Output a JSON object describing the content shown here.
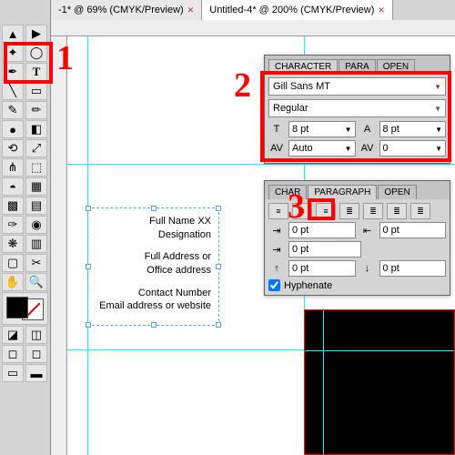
{
  "tabs": [
    {
      "label": "-1* @ 69% (CMYK/Preview)"
    },
    {
      "label": "Untitled-4* @ 200% (CMYK/Preview)"
    }
  ],
  "textbox": {
    "lines1": [
      "Full Name XX",
      "Designation"
    ],
    "lines2": [
      "Full Address or",
      "Office address"
    ],
    "lines3": [
      "Contact Number",
      "Email address or website"
    ]
  },
  "character": {
    "tabs": [
      "CHARACTER",
      "PARA",
      "OPEN"
    ],
    "font": "Gill Sans MT",
    "style": "Regular",
    "size": "8 pt",
    "leading": "8 pt",
    "kerning": "Auto",
    "tracking": "0"
  },
  "paragraph": {
    "tabs": [
      "CHAR",
      "PARAGRAPH",
      "OPEN"
    ],
    "indent_left": "0 pt",
    "indent_right": "0 pt",
    "indent_first": "0 pt",
    "space_before": "0 pt",
    "space_after": "0 pt",
    "hyphenate": "Hyphenate"
  },
  "annotations": {
    "one": "1",
    "two": "2",
    "three": "3"
  }
}
